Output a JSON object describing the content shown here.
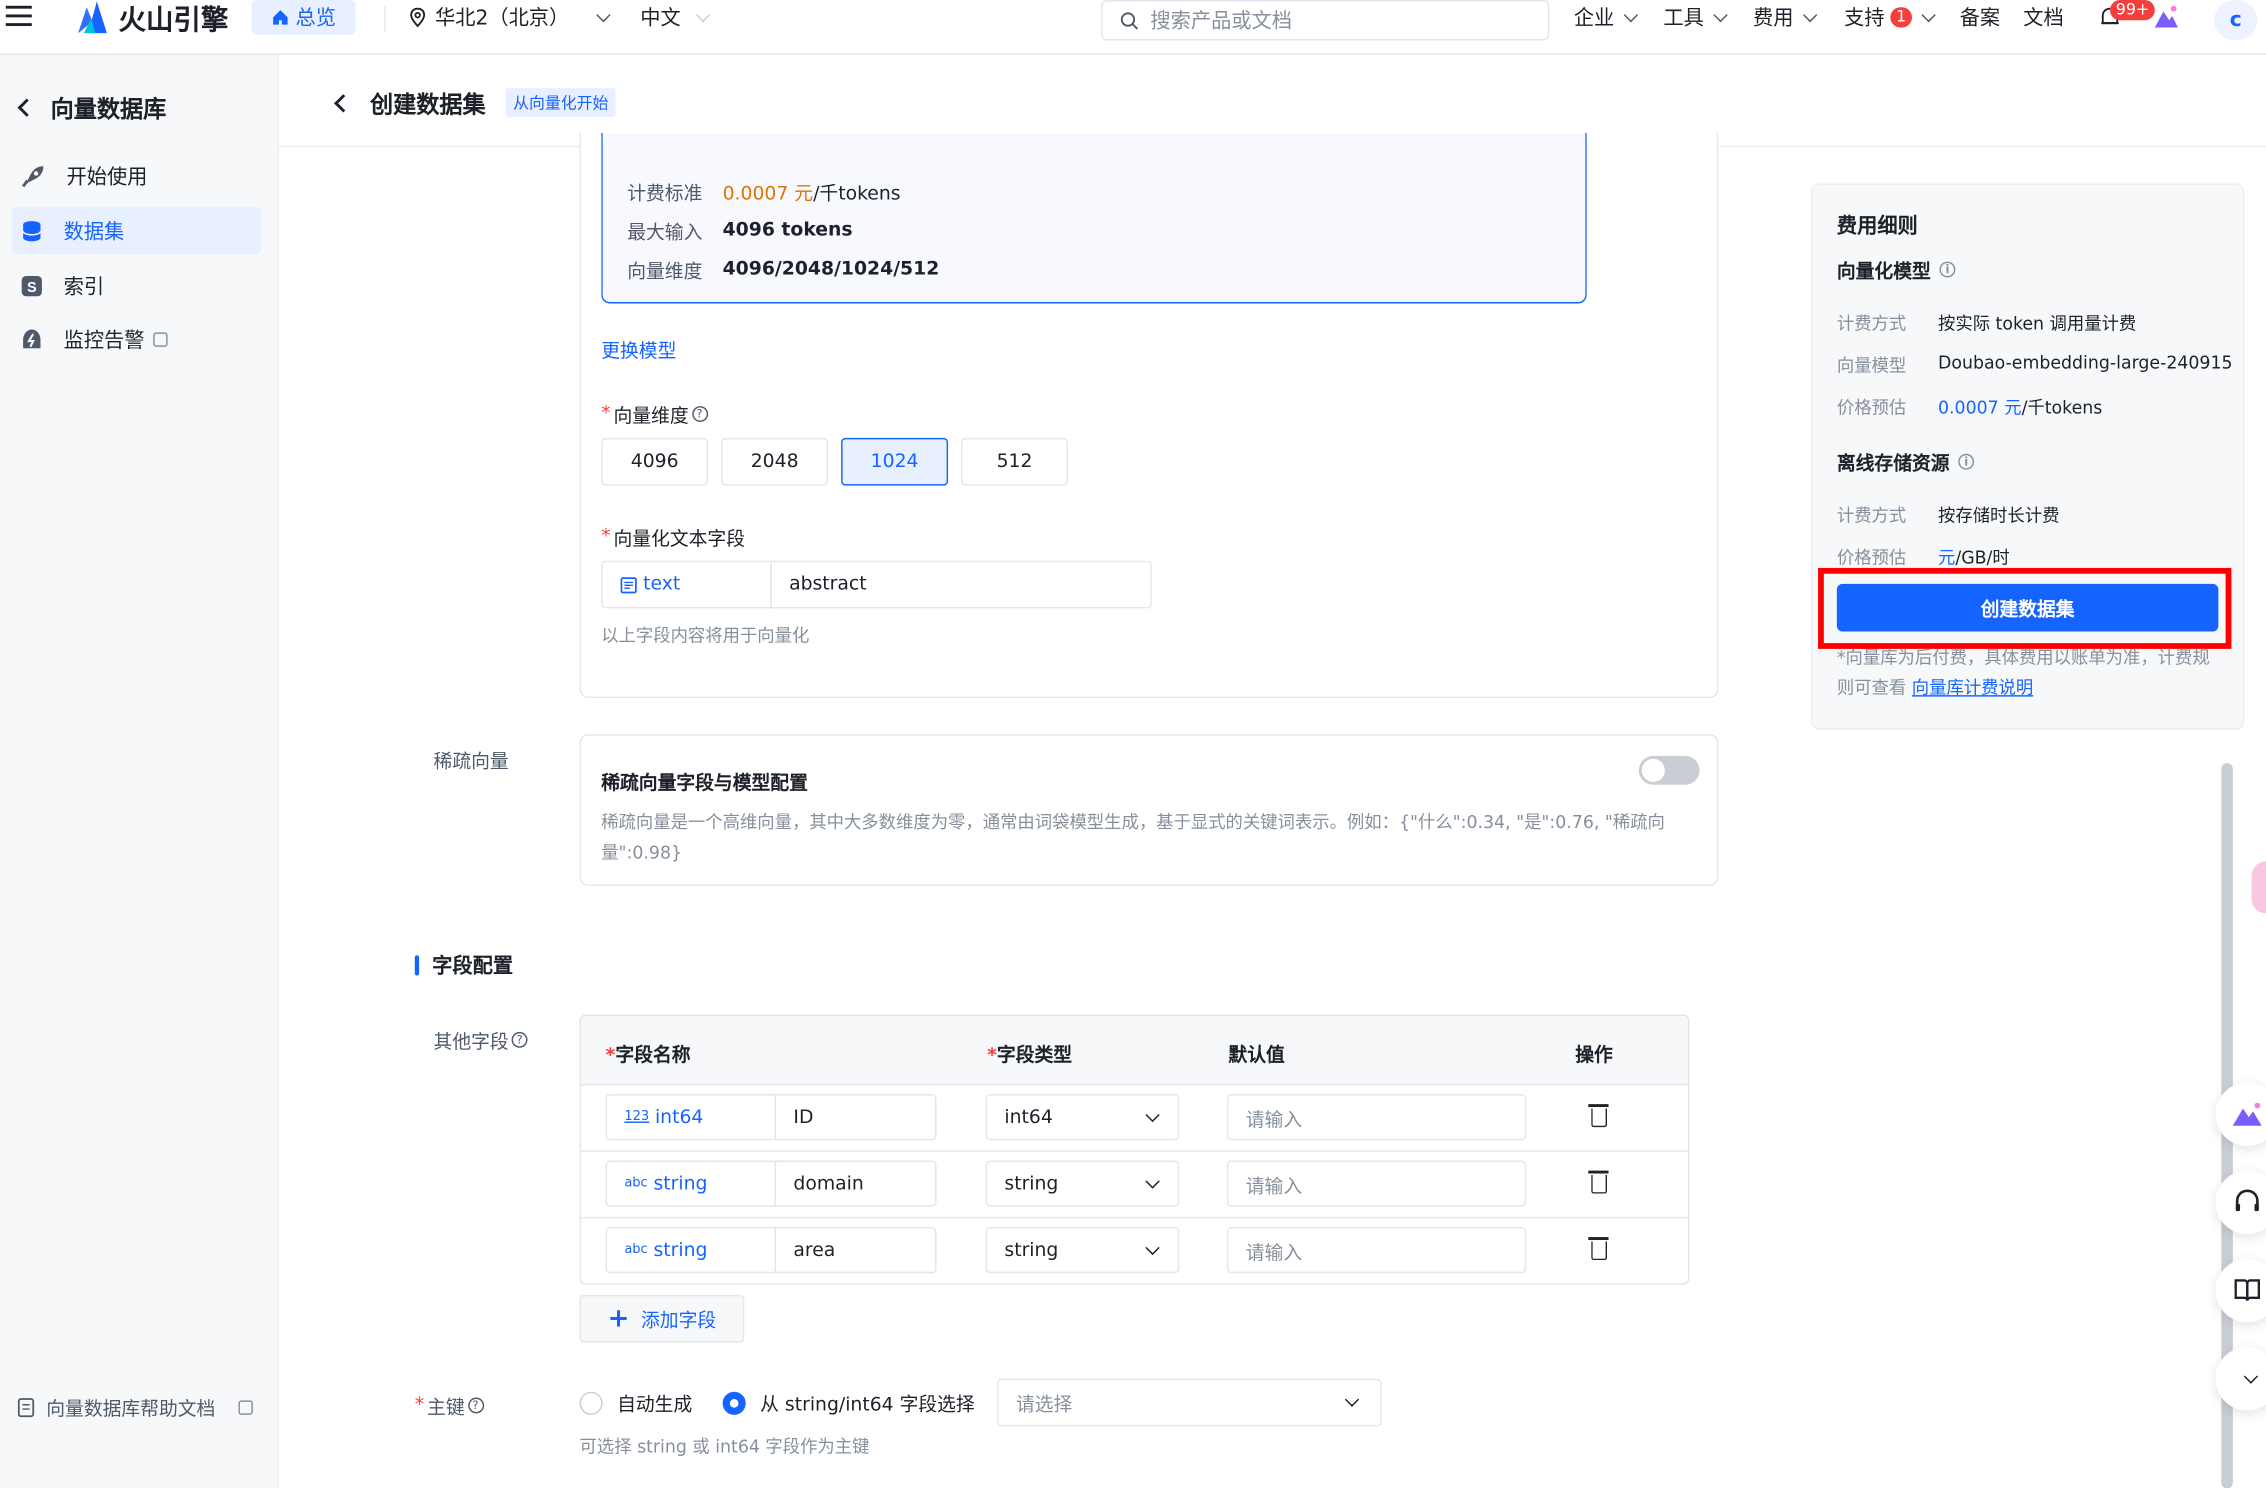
{
  "topbar": {
    "brand": "火山引擎",
    "home": "总览",
    "region": "华北2（北京）",
    "language": "中文",
    "search_placeholder": "搜索产品或文档",
    "nav": {
      "enterprise": "企业",
      "tools": "工具",
      "billing": "费用",
      "support": "支持",
      "support_badge": "1",
      "filing": "备案",
      "docs": "文档",
      "notify_badge": "99+"
    },
    "avatar": "c"
  },
  "sidebar": {
    "title": "向量数据库",
    "items": [
      {
        "label": "开始使用",
        "icon": "rocket-icon"
      },
      {
        "label": "数据集",
        "icon": "database-icon",
        "active": true
      },
      {
        "label": "索引",
        "icon": "index-icon"
      },
      {
        "label": "监控告警",
        "icon": "alert-icon",
        "external": true
      }
    ],
    "help": "向量数据库帮助文档"
  },
  "page": {
    "title": "创建数据集",
    "tag": "从向量化开始"
  },
  "model": {
    "price_label": "计费标准",
    "price_value": "0.0007 元",
    "price_unit": "/千tokens",
    "max_input_label": "最大输入",
    "max_input_value": "4096 tokens",
    "dims_label": "向量维度",
    "dims_value": "4096/2048/1024/512",
    "change_link": "更换模型"
  },
  "vector_dim": {
    "label": "向量维度",
    "options": [
      "4096",
      "2048",
      "1024",
      "512"
    ],
    "selected": "1024"
  },
  "text_field": {
    "label": "向量化文本字段",
    "type": "text",
    "value": "abstract",
    "hint": "以上字段内容将用于向量化"
  },
  "sparse": {
    "section_label": "稀疏向量",
    "title": "稀疏向量字段与模型配置",
    "enabled": false,
    "desc": "稀疏向量是一个高维向量，其中大多数维度为零，通常由词袋模型生成，基于显式的关键词表示。例如：{\"什么\":0.34, \"是\":0.76, \"稀疏向量\":0.98}"
  },
  "fields": {
    "section_title": "字段配置",
    "other_label": "其他字段",
    "headers": {
      "name": "字段名称",
      "type": "字段类型",
      "default": "默认值",
      "ops": "操作"
    },
    "rows": [
      {
        "type_tag": "int64",
        "type_icon": "123",
        "name": "ID",
        "type": "int64",
        "default_placeholder": "请输入"
      },
      {
        "type_tag": "string",
        "type_icon": "abc",
        "name": "domain",
        "type": "string",
        "default_placeholder": "请输入"
      },
      {
        "type_tag": "string",
        "type_icon": "abc",
        "name": "area",
        "type": "string",
        "default_placeholder": "请输入"
      }
    ],
    "add_label": "添加字段"
  },
  "primary_key": {
    "label": "主键",
    "option_auto": "自动生成",
    "option_select": "从 string/int64 字段选择",
    "selected": "select",
    "select_placeholder": "请选择",
    "hint": "可选择 string 或 int64 字段作为主键"
  },
  "fee": {
    "title": "费用细则",
    "vector_model": {
      "title": "向量化模型",
      "billing_label": "计费方式",
      "billing_value": "按实际 token 调用量计费",
      "model_label": "向量模型",
      "model_value": "Doubao-embedding-large-240915",
      "estimate_label": "价格预估",
      "estimate_value": "0.0007 元",
      "estimate_unit": "/千tokens"
    },
    "storage": {
      "title": "离线存储资源",
      "billing_label": "计费方式",
      "billing_value": "按存储时长计费",
      "estimate_label": "价格预估",
      "estimate_value": "元",
      "estimate_unit": "/GB/时"
    },
    "create_button": "创建数据集",
    "note": "*向量库为后付费，具体费用以账单为准，计费规则可查看",
    "note_link": "向量库计费说明"
  },
  "colors": {
    "accent": "#1664ff",
    "highlight_frame": "#ff0000",
    "price_orange": "#d97706"
  }
}
